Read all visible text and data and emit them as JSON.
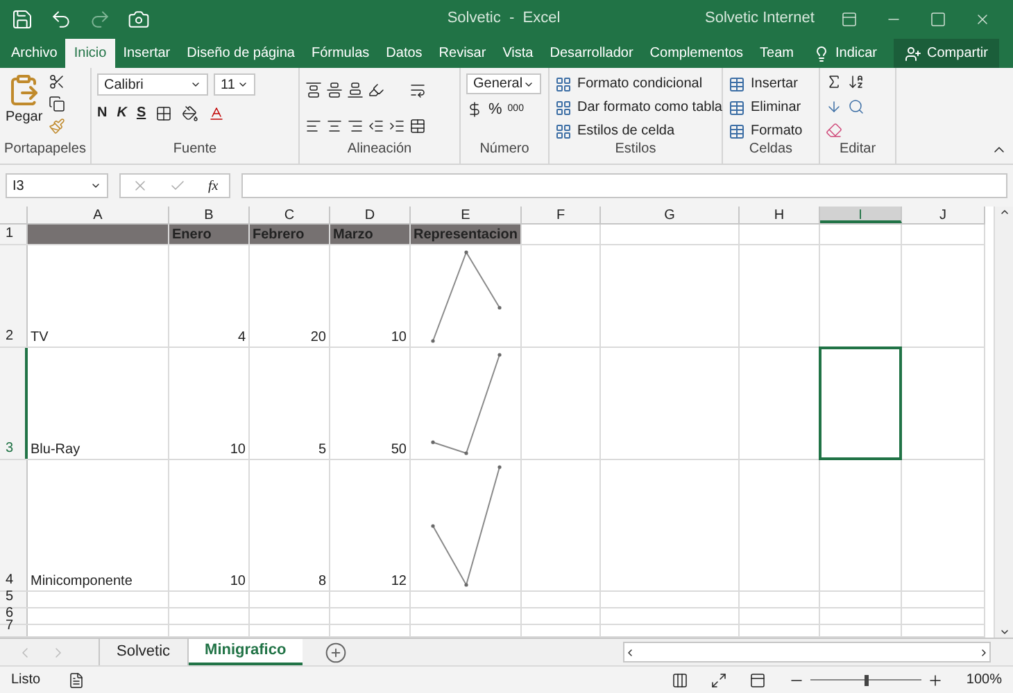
{
  "window": {
    "title": "Solvetic  -  Excel",
    "account": "Solvetic Internet"
  },
  "ribbon_tabs": [
    {
      "label": "Archivo",
      "selected": false
    },
    {
      "label": "Inicio",
      "selected": true
    },
    {
      "label": "Insertar",
      "selected": false
    },
    {
      "label": "Diseño de página",
      "selected": false
    },
    {
      "label": "Fórmulas",
      "selected": false
    },
    {
      "label": "Datos",
      "selected": false
    },
    {
      "label": "Revisar",
      "selected": false
    },
    {
      "label": "Vista",
      "selected": false
    },
    {
      "label": "Desarrollador",
      "selected": false
    },
    {
      "label": "Complementos",
      "selected": false
    },
    {
      "label": "Team",
      "selected": false
    }
  ],
  "tell_me": "Indicar",
  "share": "Compartir",
  "ribbon": {
    "clipboard": {
      "paste": "Pegar",
      "label": "Portapapeles"
    },
    "font": {
      "name": "Calibri",
      "size": "11",
      "bold": "N",
      "italic": "K",
      "underline": "S",
      "label": "Fuente"
    },
    "alignment": {
      "label": "Alineación"
    },
    "number": {
      "format": "General",
      "percent": "%",
      "thousands": "000",
      "label": "Número"
    },
    "styles": {
      "items": [
        "Formato condicional",
        "Dar formato como tabla",
        "Estilos de celda"
      ],
      "label": "Estilos"
    },
    "cells": {
      "items": [
        "Insertar",
        "Eliminar",
        "Formato"
      ],
      "label": "Celdas"
    },
    "editing": {
      "label": "Editar"
    }
  },
  "formula_bar": {
    "name_box": "I3",
    "fx": "fx"
  },
  "columns": [
    {
      "label": "A",
      "selected": false
    },
    {
      "label": "B",
      "selected": false
    },
    {
      "label": "C",
      "selected": false
    },
    {
      "label": "D",
      "selected": false
    },
    {
      "label": "E",
      "selected": false
    },
    {
      "label": "F",
      "selected": false
    },
    {
      "label": "G",
      "selected": false
    },
    {
      "label": "H",
      "selected": false
    },
    {
      "label": "I",
      "selected": true
    },
    {
      "label": "J",
      "selected": false
    }
  ],
  "rows": [
    {
      "label": "1",
      "selected": false,
      "kind": "header",
      "cells": {
        "B": "Enero",
        "C": "Febrero",
        "D": "Marzo",
        "E": "Representacion"
      }
    },
    {
      "label": "2",
      "selected": false,
      "kind": "data",
      "cells": {
        "A": "TV",
        "B": "4",
        "C": "20",
        "D": "10"
      }
    },
    {
      "label": "3",
      "selected": true,
      "kind": "data",
      "cells": {
        "A": "Blu-Ray",
        "B": "10",
        "C": "5",
        "D": "50"
      }
    },
    {
      "label": "4",
      "selected": false,
      "kind": "data",
      "cells": {
        "A": "Minicomponente",
        "B": "10",
        "C": "8",
        "D": "12"
      }
    },
    {
      "label": "5",
      "selected": false,
      "kind": "empty",
      "cells": {}
    },
    {
      "label": "6",
      "selected": false,
      "kind": "empty",
      "cells": {}
    },
    {
      "label": "7",
      "selected": false,
      "kind": "empty",
      "cells": {}
    }
  ],
  "sheet_tabs": [
    {
      "label": "Solvetic",
      "selected": false
    },
    {
      "label": "Minigrafico",
      "selected": true
    }
  ],
  "status_bar": {
    "status": "Listo",
    "zoom": "100%",
    "zoom_slider": {
      "level": 0.5
    }
  }
}
